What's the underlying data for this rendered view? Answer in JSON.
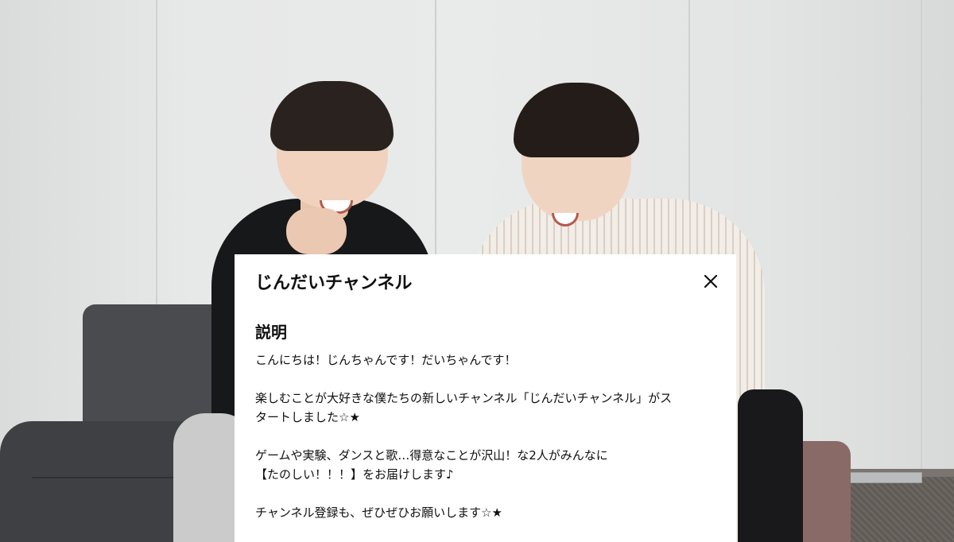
{
  "panel": {
    "title": "じんだいチャンネル",
    "close_icon": "close-icon",
    "section_title": "説明",
    "description": {
      "line1": "こんにちは！じんちゃんです！だいちゃんです！",
      "line2": "楽しむことが大好きな僕たちの新しいチャンネル「じんだいチャンネル」がス",
      "line3": "タートしました☆★",
      "line4": "ゲームや実験、ダンスと歌…得意なことが沢山！な2人がみんなに",
      "line5": "【たのしい！！！】をお届けします♪",
      "line6": "チャンネル登録も、ぜひぜひお願いします☆★"
    }
  },
  "colors": {
    "panel_background": "#ffffff",
    "text": "#0f0f0f",
    "wall": "#e4e5e5"
  }
}
